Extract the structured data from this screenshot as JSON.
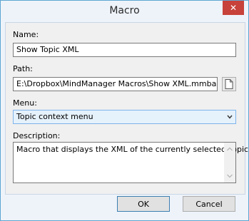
{
  "window": {
    "title": "Macro",
    "close_glyph": "✕"
  },
  "fields": {
    "name": {
      "label": "Name:",
      "value": "Show Topic XML"
    },
    "path": {
      "label": "Path:",
      "value": "E:\\Dropbox\\MindManager Macros\\Show XML.mmbas",
      "browse_icon": "file-icon"
    },
    "menu": {
      "label": "Menu:",
      "selected": "Topic context menu"
    },
    "description": {
      "label": "Description:",
      "value": "Macro that displays the XML of the currently selected Topic"
    }
  },
  "buttons": {
    "ok": "OK",
    "cancel": "Cancel"
  },
  "colors": {
    "close_button": "#c7423a",
    "window_border": "#5ea6d3",
    "select_highlight": "#e5f1fb"
  }
}
